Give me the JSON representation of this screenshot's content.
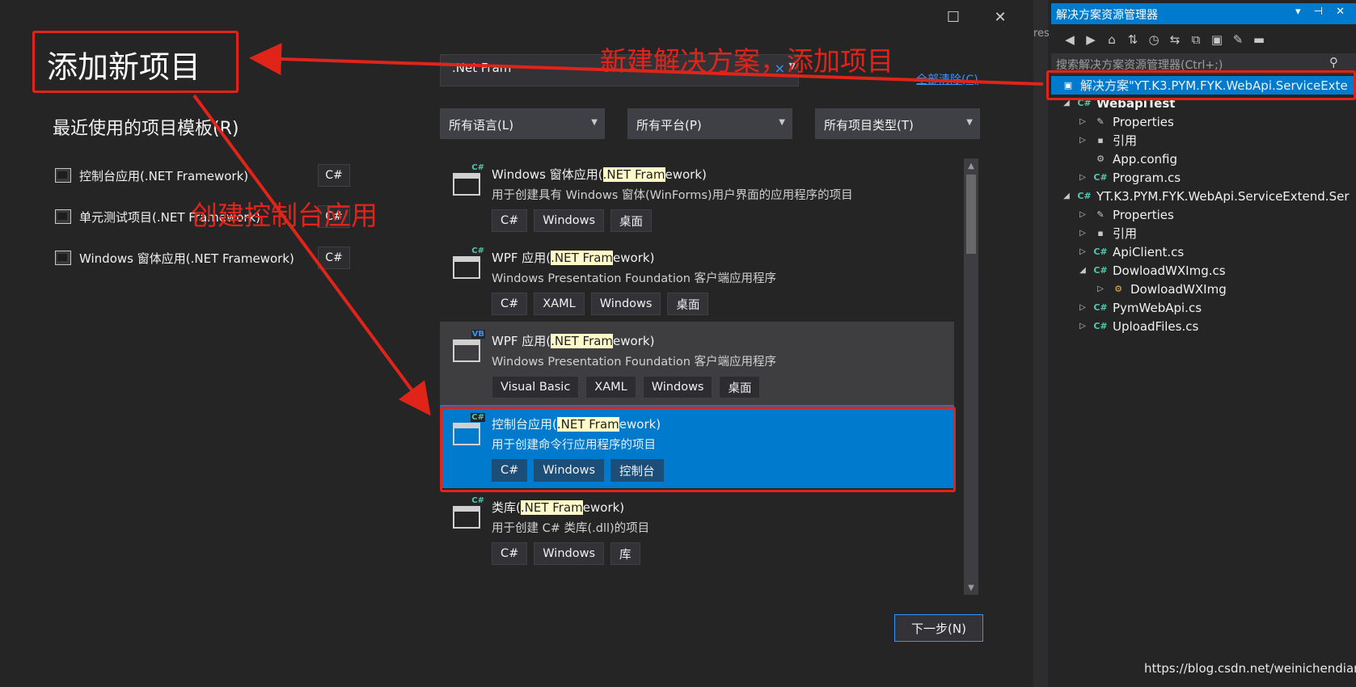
{
  "dialog": {
    "title": "添加新项目",
    "recent_heading": "最近使用的项目模板(R)",
    "recent_templates": [
      {
        "label": "控制台应用(.NET Framework)",
        "lang": "C#"
      },
      {
        "label": "单元测试项目(.NET Framework)",
        "lang": "C#"
      },
      {
        "label": "Windows 窗体应用(.NET Framework)",
        "lang": "C#"
      }
    ],
    "search": {
      "value": ".Net Fram",
      "clear_icon": "×"
    },
    "clear_all": "全部清除(C)",
    "filters": {
      "language": "所有语言(L)",
      "platform": "所有平台(P)",
      "project_type": "所有项目类型(T)"
    },
    "templates": [
      {
        "pre": "Windows 窗体应用(",
        "hl": ".NET Fram",
        "post": "ework)",
        "desc": "用于创建具有 Windows 窗体(WinForms)用户界面的应用程序的项目",
        "tags": [
          "C#",
          "Windows",
          "桌面"
        ],
        "lang_badge": "C#"
      },
      {
        "pre": "WPF 应用(",
        "hl": ".NET Fram",
        "post": "ework)",
        "desc": "Windows Presentation Foundation 客户端应用程序",
        "tags": [
          "C#",
          "XAML",
          "Windows",
          "桌面"
        ],
        "lang_badge": "C#"
      },
      {
        "pre": "WPF 应用(",
        "hl": ".NET Fram",
        "post": "ework)",
        "desc": "Windows Presentation Foundation 客户端应用程序",
        "tags": [
          "Visual Basic",
          "XAML",
          "Windows",
          "桌面"
        ],
        "lang_badge": "VB"
      },
      {
        "pre": "控制台应用(",
        "hl": ".NET Fram",
        "post": "ework)",
        "desc": "用于创建命令行应用程序的项目",
        "tags": [
          "C#",
          "Windows",
          "控制台"
        ],
        "lang_badge": "C#"
      },
      {
        "pre": "类库(",
        "hl": ".NET Fram",
        "post": "ework)",
        "desc": "用于创建 C# 类库(.dll)的项目",
        "tags": [
          "C#",
          "Windows",
          "库"
        ],
        "lang_badge": "C#"
      }
    ],
    "next_button": "下一步(N)",
    "window_buttons": {
      "maximize": "☐",
      "close": "✕"
    }
  },
  "divider_tab_fragment": "res",
  "solution_explorer": {
    "title": "解决方案资源管理器",
    "title_controls": "▾ ⊣ ✕",
    "search_placeholder": "搜索解决方案资源管理器(Ctrl+;)",
    "toolbar_icons": [
      "back-icon",
      "forward-icon",
      "home-icon",
      "sync-views-icon",
      "history-icon",
      "refresh-icon",
      "collapse-all-icon",
      "show-all-files-icon",
      "properties-icon",
      "preview-icon"
    ],
    "tree": [
      {
        "label": "解决方案\"YT.K3.PYM.FYK.WebApi.ServiceExte",
        "level": 0,
        "type": "solution",
        "twisty": ""
      },
      {
        "label": "WebapiTest",
        "level": 0,
        "type": "project",
        "twisty": "◢",
        "icon": "C#"
      },
      {
        "label": "Properties",
        "level": 1,
        "type": "properties",
        "twisty": "▷",
        "icon": "🔧"
      },
      {
        "label": "引用",
        "level": 1,
        "type": "references",
        "twisty": "▷",
        "icon": "▪"
      },
      {
        "label": "App.config",
        "level": 1,
        "type": "config",
        "twisty": "",
        "icon": "⚙"
      },
      {
        "label": "Program.cs",
        "level": 1,
        "type": "cs",
        "twisty": "▷",
        "icon": "C#"
      },
      {
        "label": "YT.K3.PYM.FYK.WebApi.ServiceExtend.Ser",
        "level": 0,
        "type": "project",
        "twisty": "◢",
        "icon": "C#"
      },
      {
        "label": "Properties",
        "level": 1,
        "type": "properties",
        "twisty": "▷",
        "icon": "🔧"
      },
      {
        "label": "引用",
        "level": 1,
        "type": "references",
        "twisty": "▷",
        "icon": "▪"
      },
      {
        "label": "ApiClient.cs",
        "level": 1,
        "type": "cs",
        "twisty": "▷",
        "icon": "C#"
      },
      {
        "label": "DowloadWXImg.cs",
        "level": 1,
        "type": "cs",
        "twisty": "◢",
        "icon": "C#"
      },
      {
        "label": "DowloadWXImg",
        "level": 2,
        "type": "class",
        "twisty": "▷",
        "icon": "⚙"
      },
      {
        "label": "PymWebApi.cs",
        "level": 1,
        "type": "cs",
        "twisty": "▷",
        "icon": "C#"
      },
      {
        "label": "UploadFiles.cs",
        "level": 1,
        "type": "cs",
        "twisty": "▷",
        "icon": "C#"
      }
    ]
  },
  "annotations": {
    "new_solution": "新建解决方案，添加项目",
    "create_console": "创建控制台应用"
  },
  "watermark": "https://blog.csdn.net/weinichendian",
  "colors": {
    "accent": "#007acc",
    "annotation_red": "#e0241a",
    "highlight": "#fffbc8"
  }
}
